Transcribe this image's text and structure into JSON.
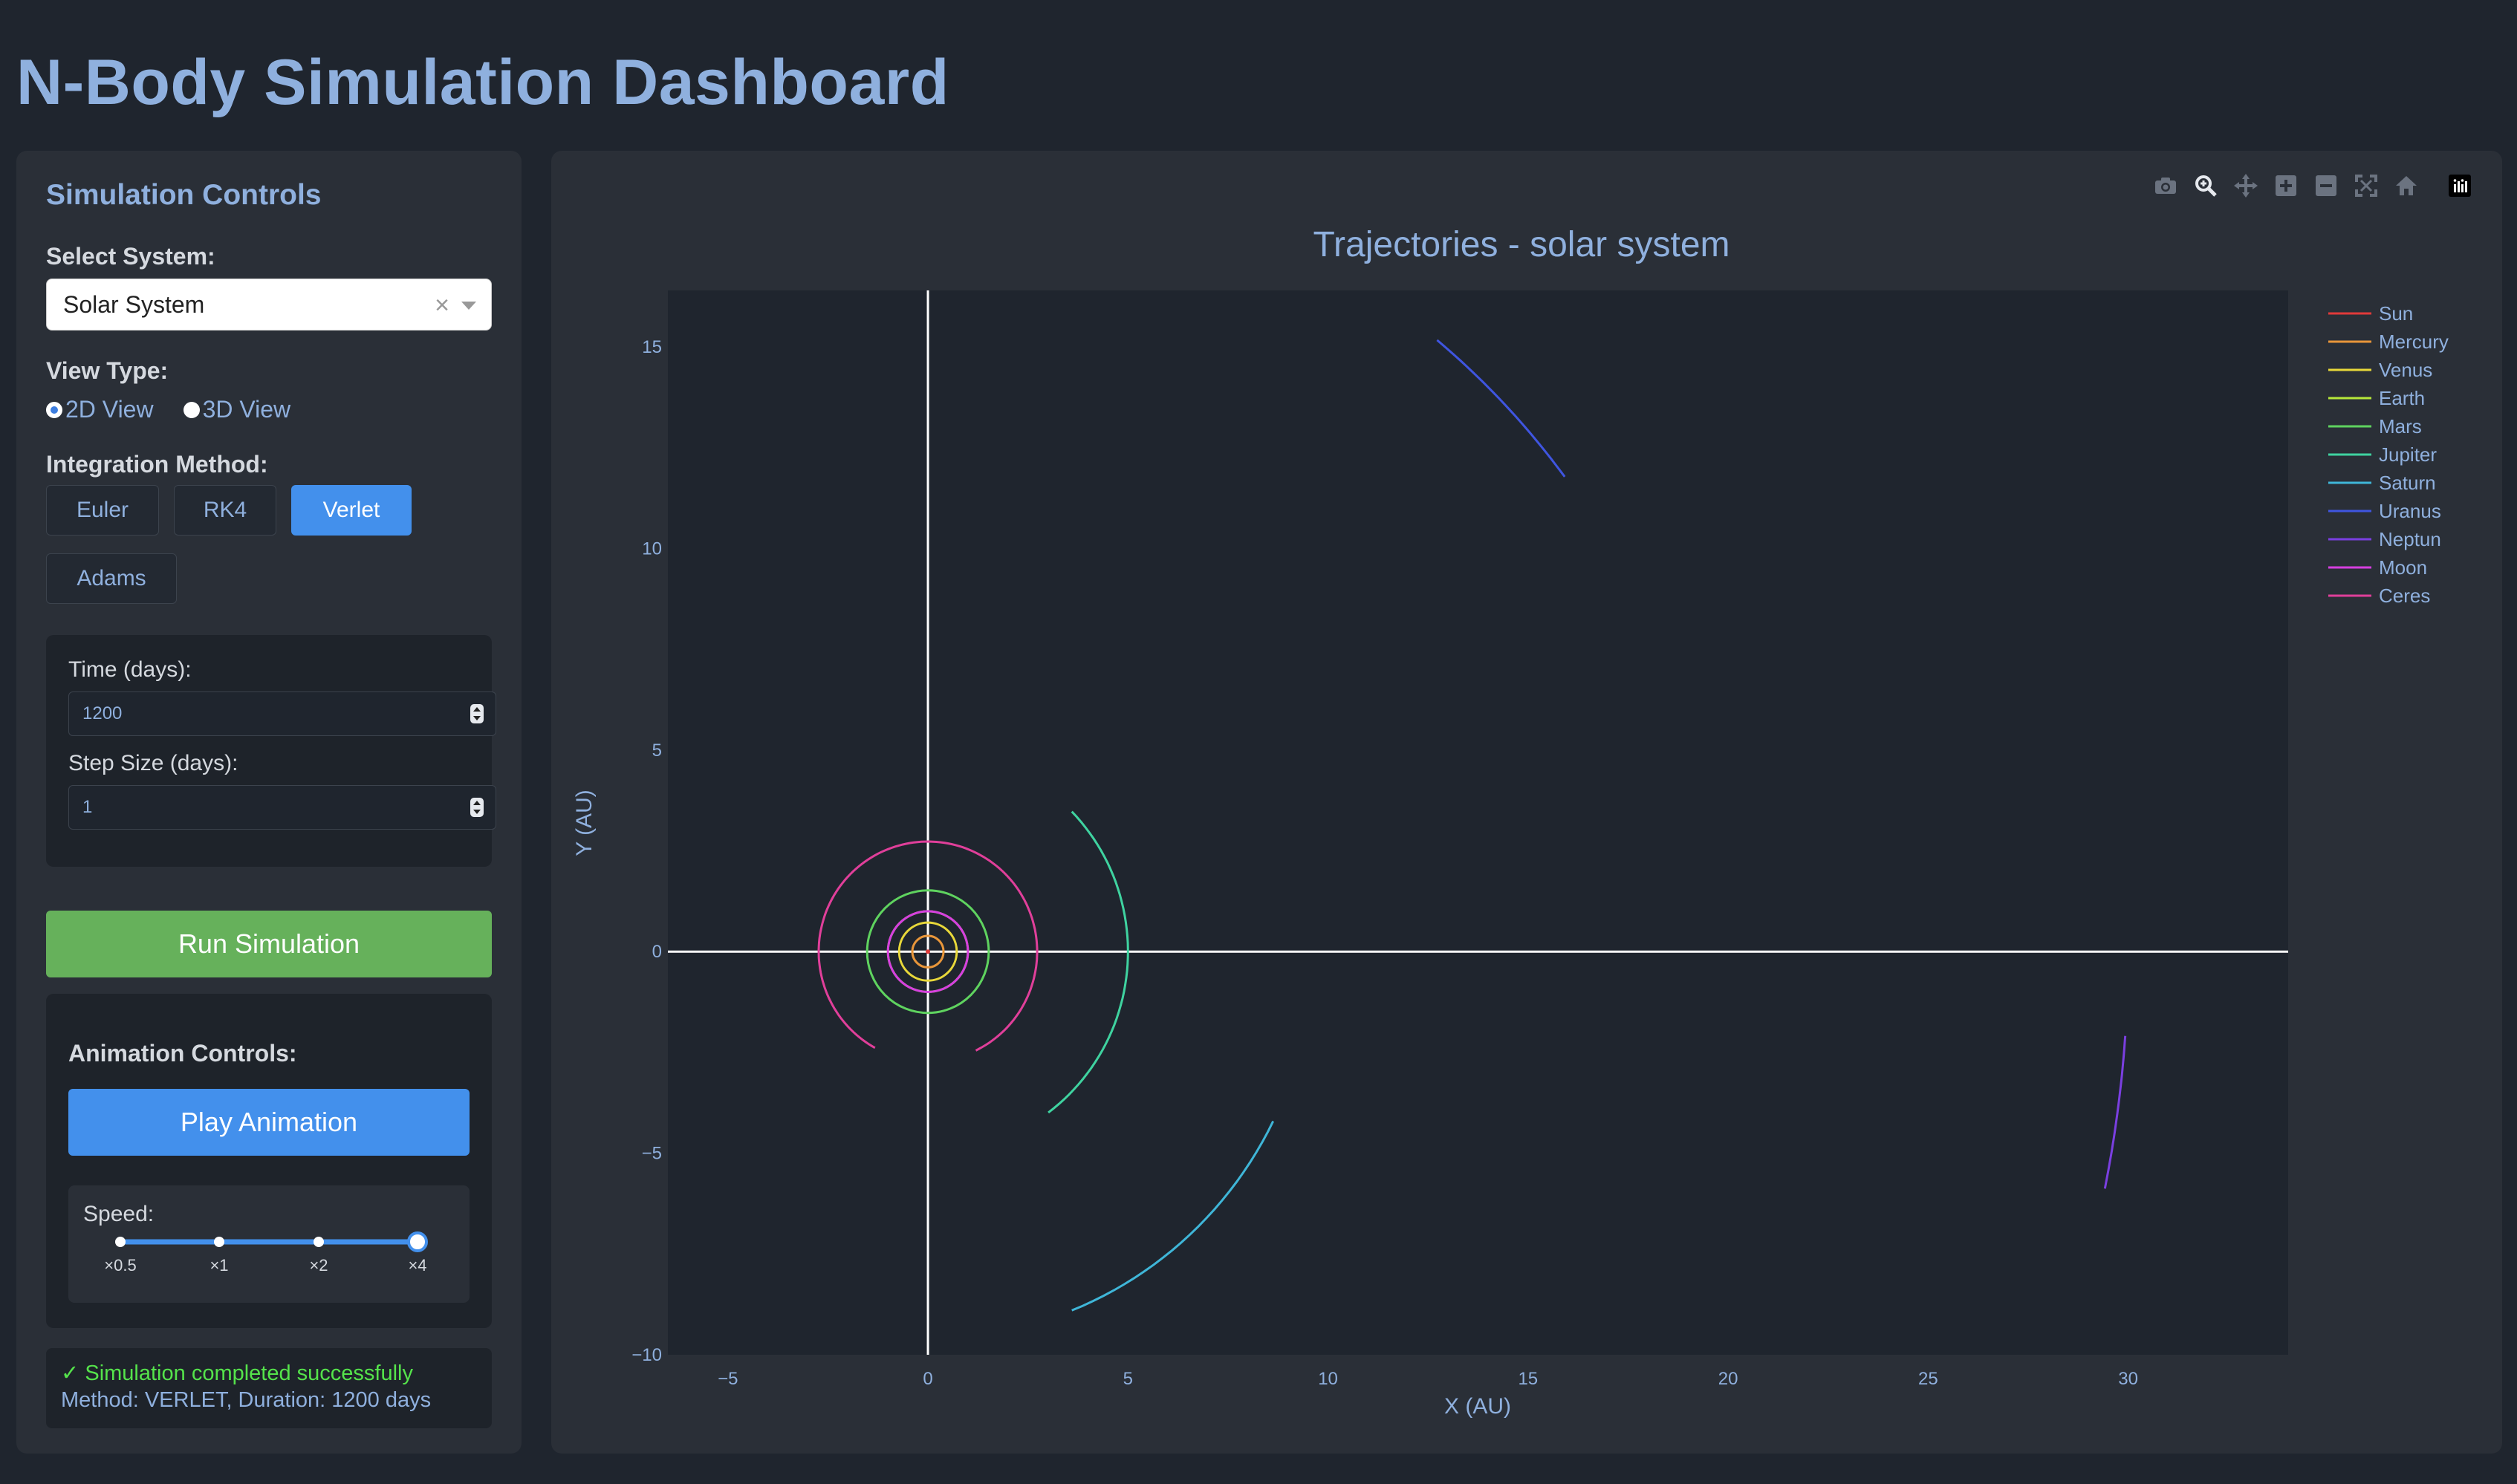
{
  "page": {
    "title": "N-Body Simulation Dashboard"
  },
  "controls": {
    "title": "Simulation Controls",
    "system_label": "Select System:",
    "system_value": "Solar System",
    "clear_symbol": "×",
    "view_label": "View Type:",
    "view_options": [
      "2D View",
      "3D View"
    ],
    "view_selected": "2D View",
    "method_label": "Integration Method:",
    "methods": [
      "Euler",
      "RK4",
      "Verlet",
      "Adams"
    ],
    "method_active": "Verlet",
    "time_label": "Time (days):",
    "time_value": "1200",
    "step_label": "Step Size (days):",
    "step_value": "1",
    "run_label": "Run Simulation"
  },
  "animation": {
    "title": "Animation Controls:",
    "play_label": "Play Animation",
    "speed_label": "Speed:",
    "speed_marks": [
      "×0.5",
      "×1",
      "×2",
      "×4"
    ],
    "speed_selected": "×4"
  },
  "status": {
    "line1": "✓ Simulation completed successfully",
    "line2": "Method: VERLET, Duration: 1200 days"
  },
  "modebar": [
    "camera-icon",
    "zoom-icon",
    "pan-icon",
    "zoom-in-icon",
    "zoom-out-icon",
    "autoscale-icon",
    "reset-axes-icon",
    "plotly-logo-icon"
  ],
  "colors": {
    "accent": "#4390ec",
    "title": "#8fb0de",
    "run": "#66b15b",
    "success": "#55e34b"
  },
  "chart_data": {
    "type": "line",
    "title": "Trajectories - solar system",
    "xlabel": "X (AU)",
    "ylabel": "Y (AU)",
    "xlim": [
      -6.5,
      34
    ],
    "ylim": [
      -10,
      16.4
    ],
    "xticks": [
      -5,
      0,
      5,
      10,
      15,
      20,
      25,
      30
    ],
    "yticks": [
      -10,
      -5,
      0,
      5,
      10,
      15
    ],
    "legend_position": "right",
    "grid": false,
    "series": [
      {
        "name": "Sun",
        "color": "#e03a3a",
        "arc": {
          "r": 0.01,
          "start": 0,
          "end": 360
        }
      },
      {
        "name": "Mercury",
        "color": "#e8963a",
        "arc": {
          "r": 0.39,
          "start": 0,
          "end": 360
        }
      },
      {
        "name": "Venus",
        "color": "#e8d83a",
        "arc": {
          "r": 0.72,
          "start": 0,
          "end": 360
        }
      },
      {
        "name": "Earth",
        "color": "#b6e83a",
        "arc": {
          "r": 1.0,
          "start": 0,
          "end": 360
        }
      },
      {
        "name": "Mars",
        "color": "#5fd35f",
        "arc": {
          "r": 1.52,
          "start": 0,
          "end": 360
        }
      },
      {
        "name": "Jupiter",
        "color": "#3fd3a0",
        "arc": {
          "r": 5.0,
          "start": 307,
          "end": 404
        }
      },
      {
        "name": "Saturn",
        "color": "#3fb6d8",
        "arc": {
          "r": 9.6,
          "start": 292,
          "end": 334
        }
      },
      {
        "name": "Uranus",
        "color": "#3f55e0",
        "arc": {
          "r": 19.8,
          "start": 36.5,
          "end": 50
        }
      },
      {
        "name": "Neptun",
        "color": "#7a3fe0",
        "arc": {
          "r": 30.0,
          "start": -11.3,
          "end": -4
        }
      },
      {
        "name": "Moon",
        "color": "#d63fe0",
        "arc": {
          "r": 1.0,
          "start": 0,
          "end": 360
        }
      },
      {
        "name": "Ceres",
        "color": "#e03f9a",
        "arc": {
          "r": 2.73,
          "start": 0,
          "end": 360,
          "gap": [
            -64,
            -119
          ]
        }
      }
    ]
  }
}
